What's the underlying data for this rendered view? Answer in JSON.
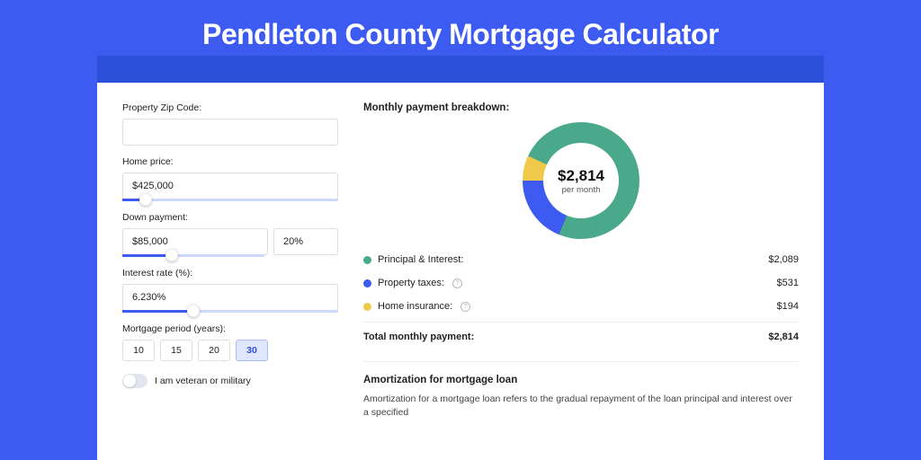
{
  "header": {
    "title": "Pendleton County Mortgage Calculator"
  },
  "form": {
    "zip": {
      "label": "Property Zip Code:",
      "value": ""
    },
    "price": {
      "label": "Home price:",
      "value": "$425,000",
      "slider_pct": 8
    },
    "down": {
      "label": "Down payment:",
      "value": "$85,000",
      "pct": "20%",
      "slider_pct": 20
    },
    "rate": {
      "label": "Interest rate (%):",
      "value": "6.230%",
      "slider_pct": 30
    },
    "period": {
      "label": "Mortgage period (years):",
      "options": [
        "10",
        "15",
        "20",
        "30"
      ],
      "selected": "30"
    },
    "veteran": {
      "label": "I am veteran or military",
      "enabled": false
    }
  },
  "breakdown": {
    "title": "Monthly payment breakdown:",
    "center_value": "$2,814",
    "center_sub": "per month",
    "items": [
      {
        "label": "Principal & Interest:",
        "amount": "$2,089",
        "color": "#4aa98a",
        "info": false
      },
      {
        "label": "Property taxes:",
        "amount": "$531",
        "color": "#3d5af1",
        "info": true
      },
      {
        "label": "Home insurance:",
        "amount": "$194",
        "color": "#f0c94a",
        "info": true
      }
    ],
    "total_label": "Total monthly payment:",
    "total_amount": "$2,814"
  },
  "chart_data": {
    "type": "pie",
    "title": "Monthly payment breakdown",
    "series": [
      {
        "name": "Principal & Interest",
        "value": 2089,
        "color": "#4aa98a"
      },
      {
        "name": "Property taxes",
        "value": 531,
        "color": "#3d5af1"
      },
      {
        "name": "Home insurance",
        "value": 194,
        "color": "#f0c94a"
      }
    ],
    "total": 2814,
    "center_label": "$2,814 per month"
  },
  "amort": {
    "title": "Amortization for mortgage loan",
    "body": "Amortization for a mortgage loan refers to the gradual repayment of the loan principal and interest over a specified"
  }
}
